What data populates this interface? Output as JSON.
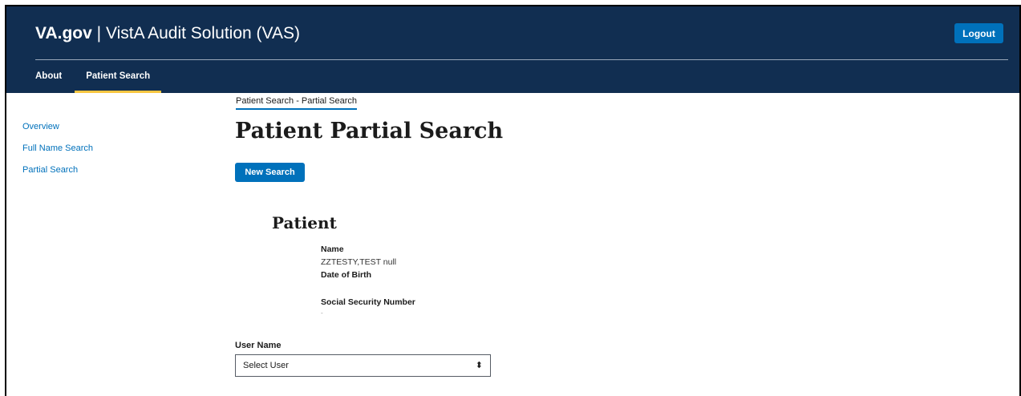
{
  "header": {
    "brand": "VA.gov",
    "separator": "|",
    "app_title": "VistA Audit Solution (VAS)",
    "logout_label": "Logout",
    "nav": [
      {
        "label": "About"
      },
      {
        "label": "Patient Search",
        "active": true
      }
    ]
  },
  "sidebar": {
    "items": [
      {
        "label": "Overview"
      },
      {
        "label": "Full Name Search"
      },
      {
        "label": "Partial Search"
      }
    ]
  },
  "main": {
    "breadcrumb": "Patient Search - Partial Search",
    "page_title": "Patient Partial Search",
    "new_search_label": "New Search",
    "patient": {
      "section_title": "Patient",
      "name_label": "Name",
      "name_value": "ZZTESTY,TEST null",
      "dob_label": "Date of Birth",
      "dob_value": "",
      "ssn_label": "Social Security Number",
      "ssn_value": "-"
    },
    "user_name_label": "User Name",
    "user_select_value": "Select User"
  },
  "colors": {
    "header_bg": "#112e51",
    "primary": "#0071bb",
    "active_tab_underline": "#f9c642"
  }
}
